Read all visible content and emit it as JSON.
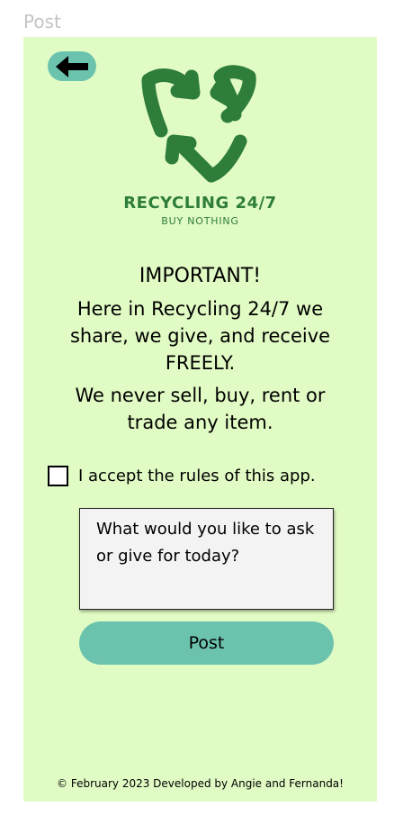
{
  "frame": {
    "label": "Post"
  },
  "brand": {
    "name": "RECYCLING 24/7",
    "tagline": "BUY NOTHING",
    "color": "#2e7d3a"
  },
  "rules": {
    "title": "IMPORTANT!",
    "line1": "Here in Recycling 24/7 we share, we give, and receive FREELY.",
    "line2": "We never sell, buy, rent or trade any item."
  },
  "accept": {
    "label": "I accept the rules of this app.",
    "checked": false
  },
  "message": {
    "placeholder": "What would you like to ask or give for today?",
    "value": ""
  },
  "post_button": {
    "label": "Post"
  },
  "footer": {
    "text": "© February 2023 Developed by Angie and Fernanda!"
  },
  "icons": {
    "back": "arrow-left-icon",
    "logo": "recycle-icon",
    "checkbox": "checkbox-unchecked"
  },
  "colors": {
    "background": "#e1fbc4",
    "accent": "#6bc3ae",
    "brand_green": "#2e7d3a"
  }
}
